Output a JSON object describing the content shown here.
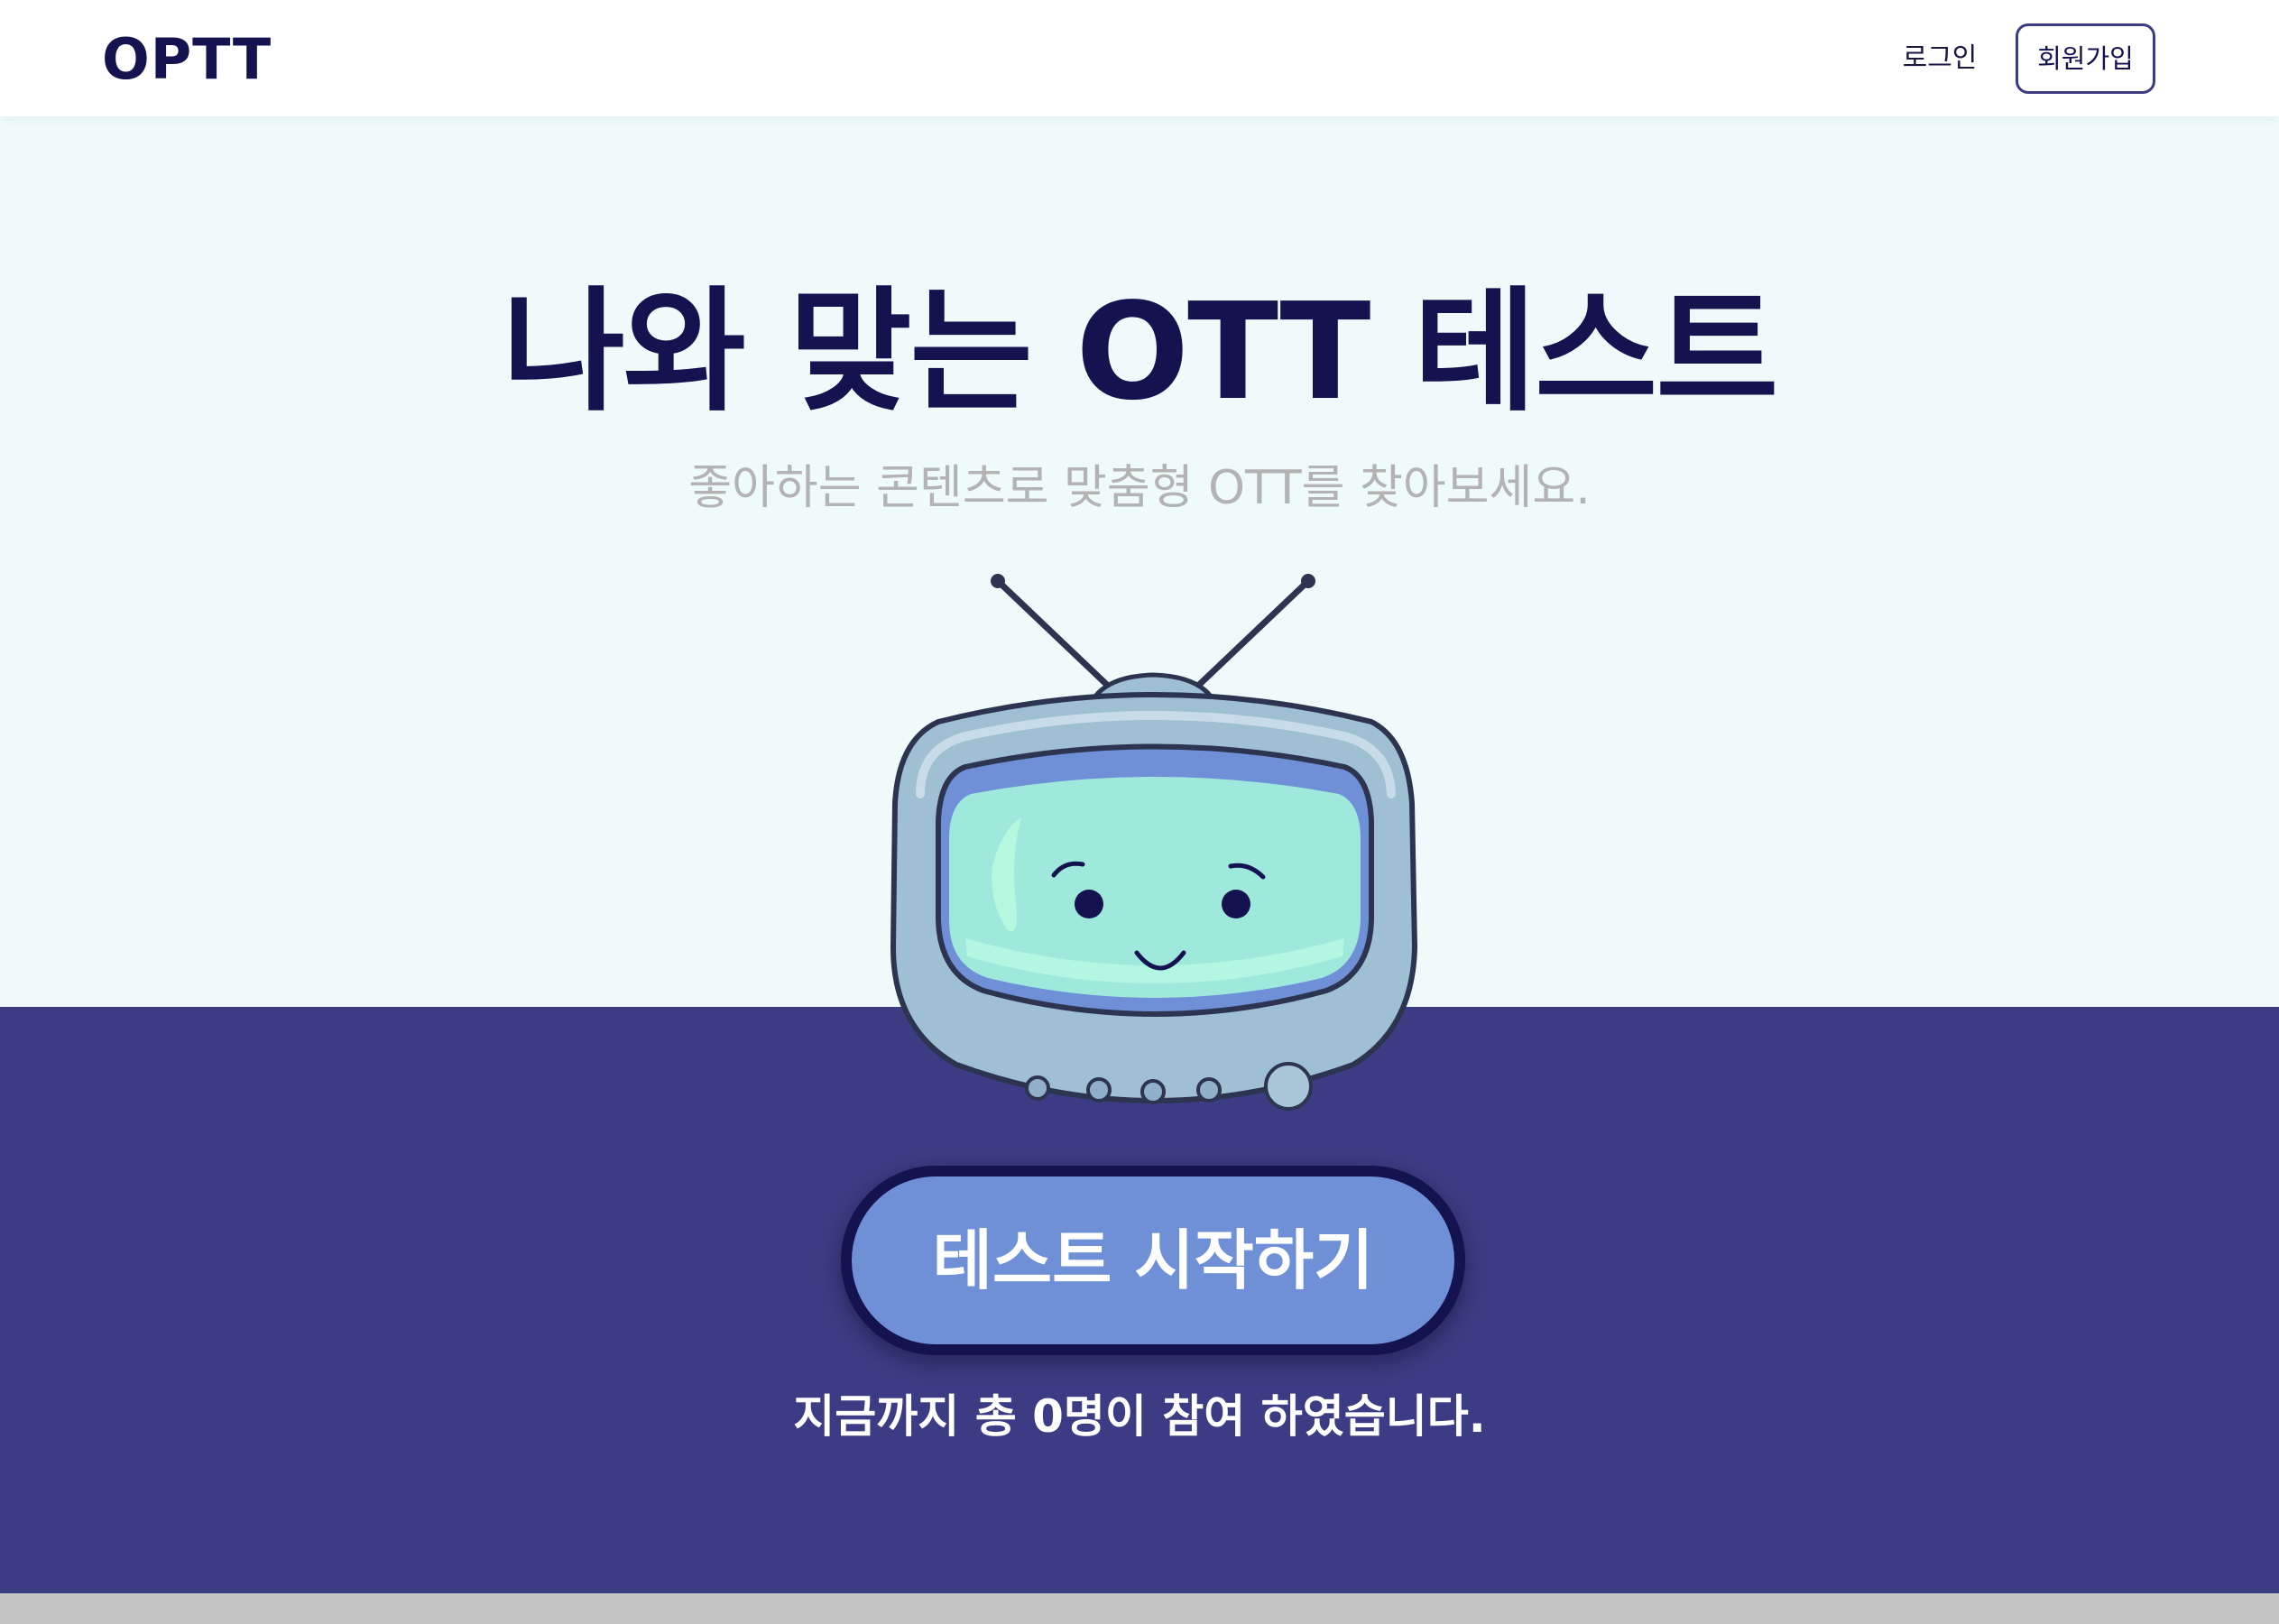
{
  "header": {
    "logo": "OPTT",
    "login_label": "로그인",
    "signup_label": "회원가입"
  },
  "hero": {
    "title": "나와 맞는 OTT 테스트",
    "subtitle": "좋아하는 콘텐츠로 맞춤형 OTT를 찾아보세요.",
    "illustration": "tv-mascot-icon"
  },
  "cta": {
    "start_label": "테스트 시작하기",
    "participants_text": "지금까지 총 0명이 참여 하였습니다."
  },
  "colors": {
    "navy": "#14124f",
    "band": "#3c3c84",
    "hero_bg": "#effbfb",
    "button": "#6f90d6",
    "screen": "#9fe9dc",
    "tv_body": "#9fbfd3"
  }
}
